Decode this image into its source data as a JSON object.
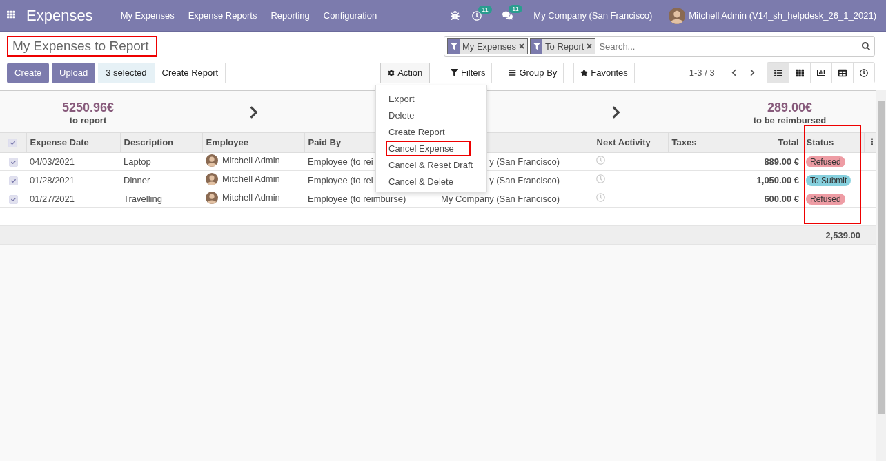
{
  "navbar": {
    "app_title": "Expenses",
    "menu": [
      "My Expenses",
      "Expense Reports",
      "Reporting",
      "Configuration"
    ],
    "activity_count": "11",
    "message_count": "11",
    "company": "My Company (San Francisco)",
    "user": "Mitchell Admin (V14_sh_helpdesk_26_1_2021)"
  },
  "control_panel": {
    "title": "My Expenses to Report",
    "title_annotated": true,
    "buttons": [
      {
        "label": "Create",
        "kind": "primary"
      },
      {
        "label": "Upload",
        "kind": "primary"
      },
      {
        "label": "3 selected",
        "kind": "info"
      },
      {
        "label": "Create Report",
        "kind": "secondary"
      }
    ],
    "action": {
      "label": "Action",
      "expanded": true,
      "items": [
        {
          "label": "Export",
          "annotated": false
        },
        {
          "label": "Delete",
          "annotated": false
        },
        {
          "label": "Create Report",
          "annotated": false
        },
        {
          "label": "Cancel Expense",
          "annotated": true
        },
        {
          "label": "Cancel & Reset Draft",
          "annotated": false
        },
        {
          "label": "Cancel & Delete",
          "annotated": false
        }
      ]
    },
    "search": {
      "facets": [
        "My Expenses",
        "To Report"
      ],
      "placeholder": "Search..."
    },
    "filters": [
      "Filters",
      "Group By",
      "Favorites"
    ],
    "pager": "1-3 / 3",
    "views": [
      {
        "kind": "list",
        "selected": true
      },
      {
        "kind": "kanban",
        "selected": false
      },
      {
        "kind": "graph",
        "selected": false
      },
      {
        "kind": "pivot",
        "selected": false
      },
      {
        "kind": "activity",
        "selected": false
      }
    ]
  },
  "summary": [
    {
      "amount": "5250.96€",
      "label": "to report"
    },
    {
      "amount": "289.00€",
      "label": "to be reimbursed"
    }
  ],
  "table": {
    "all_selected": true,
    "columns": [
      {
        "label": "Expense Date"
      },
      {
        "label": "Description"
      },
      {
        "label": "Employee"
      },
      {
        "label": "Paid By"
      },
      {
        "label": "Next Activity"
      },
      {
        "label": "Taxes"
      },
      {
        "label": "Total"
      },
      {
        "label": "Status",
        "annotated": true
      }
    ],
    "rows": [
      {
        "checked": true,
        "date": "04/03/2021",
        "description": "Laptop",
        "employee": "Mitchell Admin",
        "paid_by": "Employee (to rei",
        "column_5": "y (San Francisco)",
        "total": "889.00 €",
        "status": {
          "label": "Refused",
          "color": "#ee9ca4"
        }
      },
      {
        "checked": true,
        "date": "01/28/2021",
        "description": "Dinner",
        "employee": "Mitchell Admin",
        "paid_by": "Employee (to rei",
        "column_5": "y (San Francisco)",
        "total": "1,050.00 €",
        "status": {
          "label": "To Submit",
          "color": "#86d0de"
        }
      },
      {
        "checked": true,
        "date": "01/27/2021",
        "description": "Travelling",
        "employee": "Mitchell Admin",
        "paid_by": "Employee (to reimburse)",
        "column_5": "My Company (San Francisco)",
        "total": "600.00 €",
        "status": {
          "label": "Refused",
          "color": "#ee9ca4"
        }
      }
    ],
    "footer_total": "2,539.00"
  }
}
